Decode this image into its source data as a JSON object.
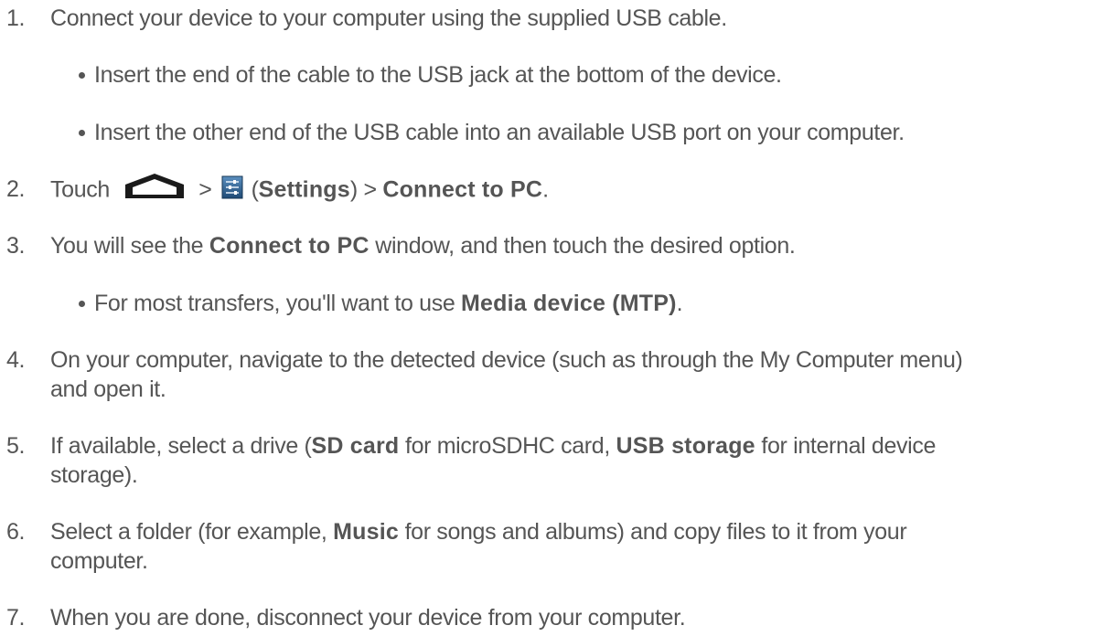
{
  "steps": [
    {
      "number": "1.",
      "text": "Connect your device to your computer using the supplied USB cable.",
      "bullets": [
        "Insert the end of the cable to the USB jack at the bottom of the device.",
        "Insert the other end of the USB cable into an available USB port on your computer."
      ]
    },
    {
      "number": "2.",
      "text_before": "Touch",
      "sep1": ">",
      "paren_open": "(",
      "settings_label": "Settings",
      "paren_close": ")",
      "sep2": ">",
      "connect_label": "Connect to PC",
      "period": ".",
      "icons": [
        "home-icon",
        "settings-icon"
      ]
    },
    {
      "number": "3.",
      "text_before": "You will see the",
      "bold": "Connect to PC",
      "text_after": "window, and then touch the desired option.",
      "bullets": [
        {
          "text_before": "For most transfers, you'll want to use",
          "bold": "Media device (MTP)",
          "text_after": "."
        }
      ]
    },
    {
      "number": "4.",
      "line1": "On your computer, navigate to the detected device (such as through the My Computer menu)",
      "line2": "and open it."
    },
    {
      "number": "5.",
      "text_before": "If available, select a drive (",
      "bold1": "SD card",
      "text_mid": "for microSDHC card,",
      "bold2": "USB storage",
      "text_after": "for internal device",
      "line2": "storage)."
    },
    {
      "number": "6.",
      "text_before": "Select a folder (for example,",
      "bold": "Music",
      "text_after": "for songs and albums) and copy files to it from your",
      "line2": "computer."
    },
    {
      "number": "7.",
      "text": "When you are done, disconnect your device from your computer."
    }
  ],
  "colors": {
    "text": "#555555",
    "settings_icon_bg": "#2b5f8f"
  }
}
